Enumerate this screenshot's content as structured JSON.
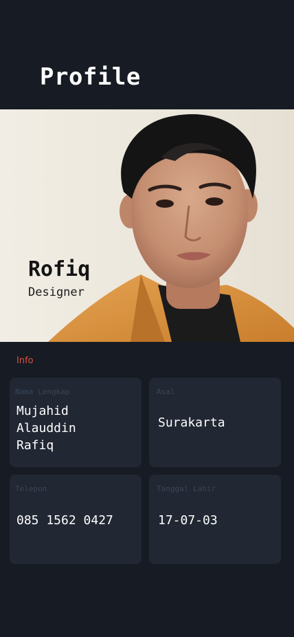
{
  "header": {
    "title": "Profile"
  },
  "hero": {
    "name": "Rofiq",
    "role": "Designer"
  },
  "info": {
    "section_label": "Info",
    "fields": [
      {
        "label": "Nama Lengkap",
        "value_lines": [
          "Mujahid",
          "Alauddin",
          "Rafiq"
        ]
      },
      {
        "label": "Asal",
        "value": "Surakarta"
      },
      {
        "label": "Telepon",
        "value": "085 1562 0427"
      },
      {
        "label": "Tanggal Lahir",
        "value": "17-07-03"
      }
    ]
  },
  "colors": {
    "background": "#171b23",
    "card": "#212733",
    "accent": "#e0533f",
    "label": "#3a4657"
  }
}
